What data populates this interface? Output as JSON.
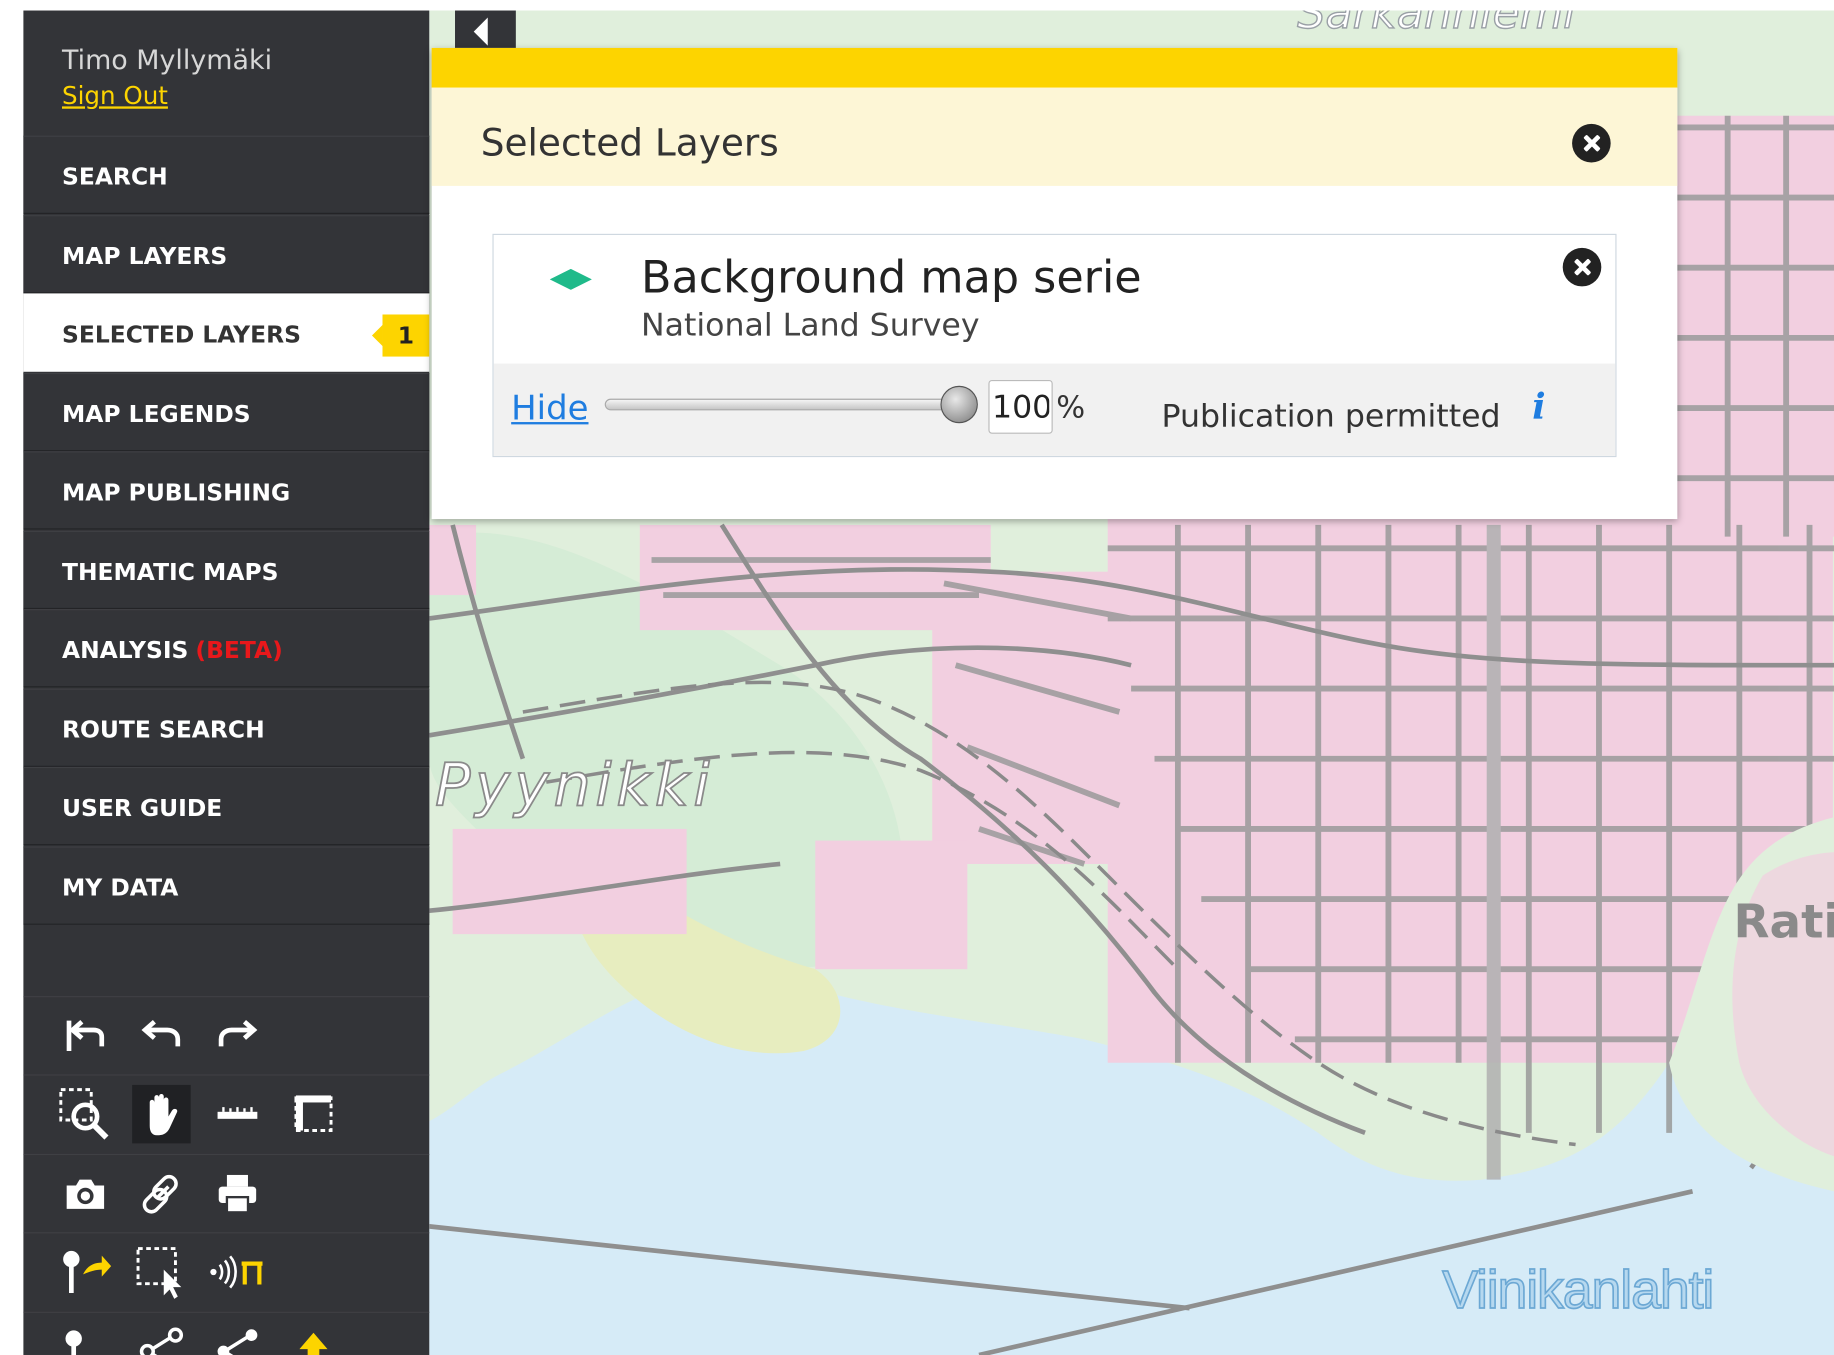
{
  "user": {
    "name": "Timo Myllymäki",
    "sign_out": "Sign Out"
  },
  "menu": {
    "items": [
      {
        "label": "SEARCH"
      },
      {
        "label": "MAP LAYERS"
      },
      {
        "label": "SELECTED LAYERS",
        "active": true,
        "badge": "1"
      },
      {
        "label": "MAP LEGENDS"
      },
      {
        "label": "MAP PUBLISHING"
      },
      {
        "label": "THEMATIC MAPS"
      },
      {
        "label": "ANALYSIS",
        "suffix": "(BETA)"
      },
      {
        "label": "ROUTE SEARCH"
      },
      {
        "label": "USER GUIDE"
      },
      {
        "label": "MY DATA"
      }
    ]
  },
  "tools": [
    [
      "reset-view-icon",
      "undo-icon",
      "redo-icon"
    ],
    [
      "zoom-box-icon",
      "pan-hand-icon",
      "measure-line-icon",
      "measure-area-icon"
    ],
    [
      "camera-icon",
      "link-icon",
      "print-icon"
    ],
    [
      "get-feature-info-icon",
      "select-features-icon",
      "broadcast-icon"
    ],
    [
      "marker-icon",
      "share-icon",
      "share-alt-icon",
      "upload-icon"
    ]
  ],
  "panel": {
    "title": "Selected Layers",
    "layer": {
      "name": "Background map serie",
      "organization": "National Land Survey",
      "hide_label": "Hide",
      "opacity": "100",
      "opacity_unit": "%",
      "publication": "Publication permitted",
      "info": "i"
    }
  },
  "map": {
    "labels": {
      "district": "Pyynikki",
      "bay": "Viinikanlahti",
      "partial_right": "Rati",
      "partial_top": "Särkänniemi"
    }
  },
  "colors": {
    "accent": "#fdd400",
    "sidebar": "#333438",
    "link": "#1f7de0",
    "beta": "#e8181b"
  }
}
